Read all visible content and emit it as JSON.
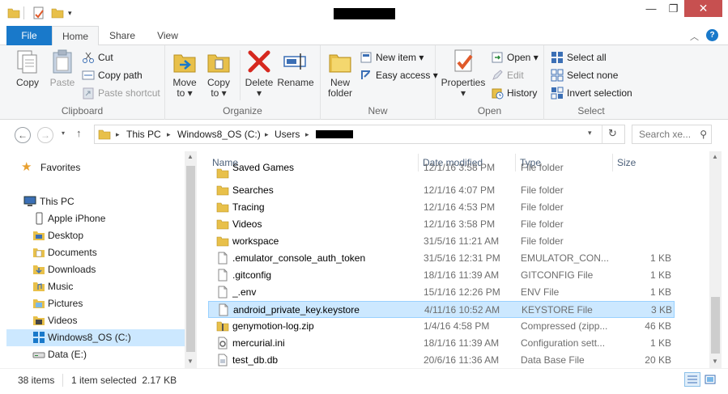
{
  "window": {
    "minimize_glyph": "—",
    "maximize_glyph": "❐",
    "close_glyph": "✕"
  },
  "tabs": {
    "file": "File",
    "home": "Home",
    "share": "Share",
    "view": "View"
  },
  "ribbon": {
    "clipboard": {
      "label": "Clipboard",
      "copy": "Copy",
      "paste": "Paste",
      "cut": "Cut",
      "copy_path": "Copy path",
      "paste_shortcut": "Paste shortcut"
    },
    "organize": {
      "label": "Organize",
      "move_to": "Move",
      "move_to_2": "to ▾",
      "copy_to": "Copy",
      "copy_to_2": "to ▾",
      "delete": "Delete",
      "delete_2": "▾",
      "rename": "Rename"
    },
    "new": {
      "label": "New",
      "new_folder": "New",
      "new_folder_2": "folder",
      "new_item": "New item ▾",
      "easy_access": "Easy access ▾"
    },
    "open": {
      "label": "Open",
      "properties": "Properties",
      "properties_2": "▾",
      "open": "Open ▾",
      "edit": "Edit",
      "history": "History"
    },
    "select": {
      "label": "Select",
      "select_all": "Select all",
      "select_none": "Select none",
      "invert_selection": "Invert selection"
    }
  },
  "address": {
    "crumbs": [
      "This PC",
      "Windows8_OS (C:)",
      "Users"
    ],
    "search_placeholder": "Search xe..."
  },
  "nav": {
    "favorites": "Favorites",
    "this_pc": "This PC",
    "items": [
      "Apple iPhone",
      "Desktop",
      "Documents",
      "Downloads",
      "Music",
      "Pictures",
      "Videos",
      "Windows8_OS (C:)",
      "Data (E:)"
    ]
  },
  "columns": {
    "name": "Name",
    "date": "Date modified",
    "type": "Type",
    "size": "Size"
  },
  "files": [
    {
      "name": "Saved Games",
      "date": "12/1/16 3:58 PM",
      "type": "File folder",
      "size": "",
      "kind": "folder"
    },
    {
      "name": "Searches",
      "date": "12/1/16 4:07 PM",
      "type": "File folder",
      "size": "",
      "kind": "folder"
    },
    {
      "name": "Tracing",
      "date": "12/1/16 4:53 PM",
      "type": "File folder",
      "size": "",
      "kind": "folder"
    },
    {
      "name": "Videos",
      "date": "12/1/16 3:58 PM",
      "type": "File folder",
      "size": "",
      "kind": "folder"
    },
    {
      "name": "workspace",
      "date": "31/5/16 11:21 AM",
      "type": "File folder",
      "size": "",
      "kind": "folder"
    },
    {
      "name": ".emulator_console_auth_token",
      "date": "31/5/16 12:31 PM",
      "type": "EMULATOR_CON...",
      "size": "1 KB",
      "kind": "file"
    },
    {
      "name": ".gitconfig",
      "date": "18/1/16 11:39 AM",
      "type": "GITCONFIG File",
      "size": "1 KB",
      "kind": "file"
    },
    {
      "name": "_.env",
      "date": "15/1/16 12:26 PM",
      "type": "ENV File",
      "size": "1 KB",
      "kind": "file"
    },
    {
      "name": "android_private_key.keystore",
      "date": "4/11/16 10:52 AM",
      "type": "KEYSTORE File",
      "size": "3 KB",
      "kind": "file",
      "selected": true
    },
    {
      "name": "genymotion-log.zip",
      "date": "1/4/16 4:58 PM",
      "type": "Compressed (zipp...",
      "size": "46 KB",
      "kind": "zip"
    },
    {
      "name": "mercurial.ini",
      "date": "18/1/16 11:39 AM",
      "type": "Configuration sett...",
      "size": "1 KB",
      "kind": "ini"
    },
    {
      "name": "test_db.db",
      "date": "20/6/16 11:36 AM",
      "type": "Data Base File",
      "size": "20 KB",
      "kind": "db"
    }
  ],
  "status": {
    "items": "38 items",
    "selected": "1 item selected  2.17 KB"
  },
  "colors": {
    "accent": "#1979ca",
    "selection": "#cce8ff",
    "folder": "#e8c04a"
  }
}
